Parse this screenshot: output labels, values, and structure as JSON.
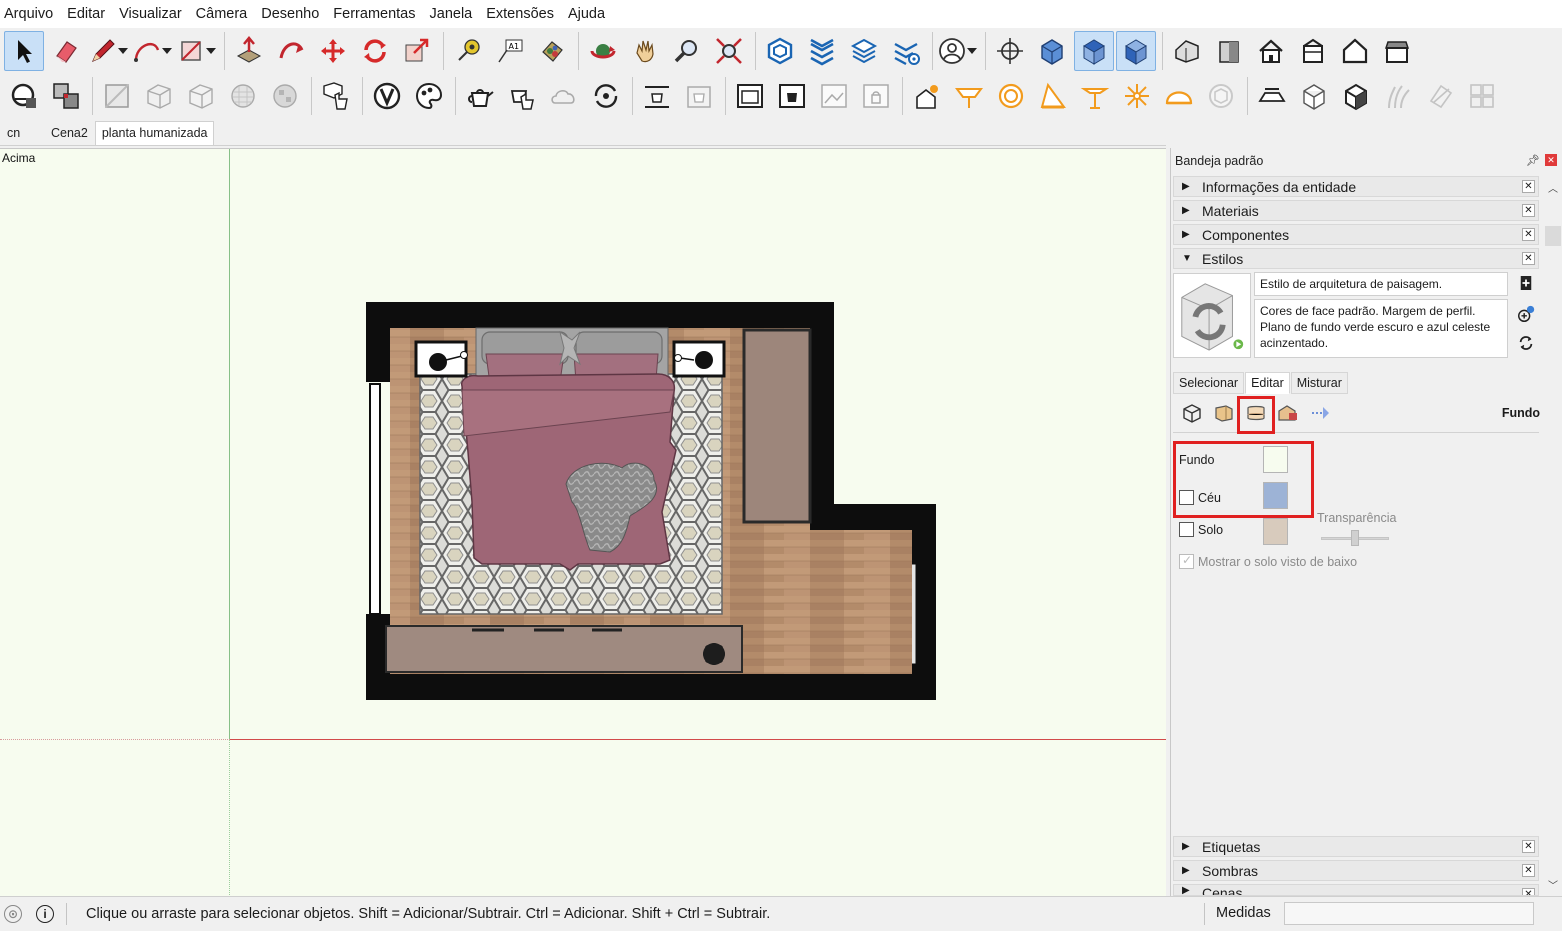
{
  "menu": [
    "Arquivo",
    "Editar",
    "Visualizar",
    "Câmera",
    "Desenho",
    "Ferramentas",
    "Janela",
    "Extensões",
    "Ajuda"
  ],
  "scenes": {
    "tabs": [
      "cn",
      "Cena2",
      "planta humanizada"
    ],
    "active_index": 2
  },
  "viewport": {
    "view_label": "Acima",
    "background_color": "#f7fcef"
  },
  "tray": {
    "title": "Bandeja padrão",
    "panels_top": [
      {
        "label": "Informações da entidade",
        "expanded": false
      },
      {
        "label": "Materiais",
        "expanded": false
      },
      {
        "label": "Componentes",
        "expanded": false
      },
      {
        "label": "Estilos",
        "expanded": true
      }
    ],
    "panels_bottom": [
      {
        "label": "Etiquetas",
        "expanded": false
      },
      {
        "label": "Sombras",
        "expanded": false
      },
      {
        "label": "Cenas",
        "expanded": false
      }
    ]
  },
  "styles": {
    "name": "Estilo de arquitetura de paisagem.",
    "description": "Cores de face padrão. Margem de perfil. Plano de fundo verde escuro e azul celeste acinzentado.",
    "tabs": [
      "Selecionar",
      "Editar",
      "Misturar"
    ],
    "active_tab": "Editar",
    "edit_section": "Fundo",
    "background": {
      "fundo_label": "Fundo",
      "fundo_color": "#f7fcef",
      "ceu_label": "Céu",
      "ceu_checked": false,
      "ceu_color": "#9db3d6",
      "transparency_label": "Transparência",
      "solo_label": "Solo",
      "solo_checked": false,
      "solo_color": "#d8cbbd",
      "show_ground_below_label": "Mostrar o solo visto de baixo",
      "show_ground_below_checked": true
    }
  },
  "status": {
    "hint": "Clique ou arraste para selecionar objetos. Shift = Adicionar/Subtrair. Ctrl = Adicionar. Shift + Ctrl = Subtrair.",
    "measures_label": "Medidas",
    "measures_value": ""
  },
  "colors": {
    "highlight": "#e02020",
    "active_tool": "#c9e0f7"
  }
}
